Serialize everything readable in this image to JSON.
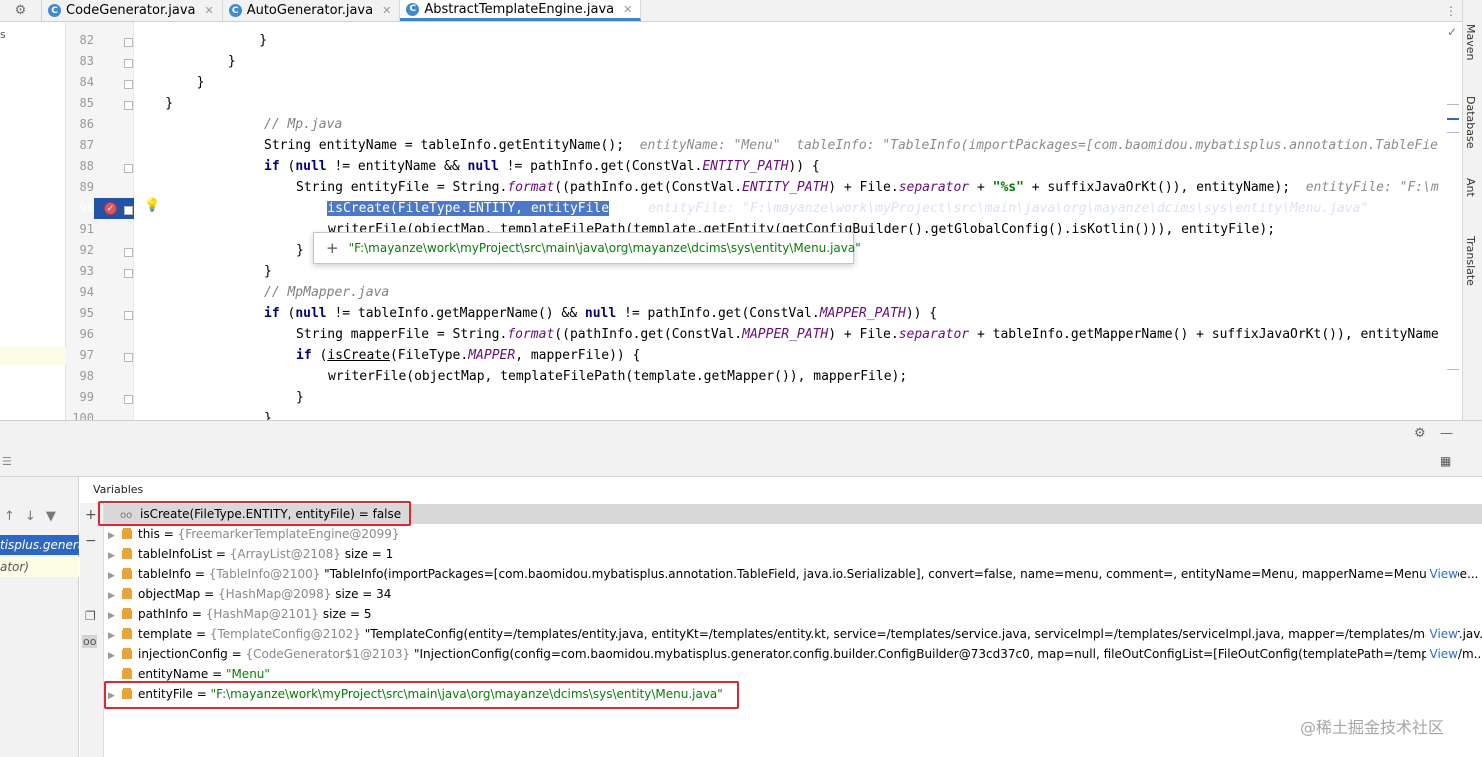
{
  "tabs": [
    {
      "label": "CodeGenerator.java",
      "icon": "C",
      "active": false
    },
    {
      "label": "AutoGenerator.java",
      "icon": "C",
      "active": false
    },
    {
      "label": "AbstractTemplateEngine.java",
      "icon": "C",
      "active": true
    }
  ],
  "left_labels": {
    "top": "s"
  },
  "line_numbers": [
    "82",
    "83",
    "84",
    "85",
    "86",
    "87",
    "88",
    "89",
    "90",
    "91",
    "92",
    "93",
    "94",
    "95",
    "96",
    "97",
    "98",
    "99",
    "100"
  ],
  "code": {
    "l82": "                }",
    "l83": "            }",
    "l84": "        }",
    "l85": "    }",
    "l86_comment": "// Mp.java",
    "l87_a": "String entityName = tableInfo.getEntityName();",
    "l87_hint": "entityName: \"Menu\"  tableInfo: \"TableInfo(importPackages=[com.baomidou.mybatisplus.annotation.TableFie",
    "l88_kw1": "if",
    "l88_a": " (",
    "l88_kw2": "null",
    "l88_b": " != entityName && ",
    "l88_kw3": "null",
    "l88_c": " != pathInfo.get(ConstVal.",
    "l88_it": "ENTITY_PATH",
    "l88_d": ")) {",
    "l89_a": "String entityFile = String.",
    "l89_it1": "format",
    "l89_b": "((pathInfo.get(ConstVal.",
    "l89_it2": "ENTITY_PATH",
    "l89_c": ") + File.",
    "l89_it3": "separator",
    "l89_d": " + ",
    "l89_str": "\"%s\"",
    "l89_e": " + suffixJavaOrKt()), entityName);",
    "l89_hint": "entityFile: \"F:\\m",
    "l90_a": "if (",
    "l90_sel1": "isCreate(FileType.ENTITY, ",
    "l90_sel2": "entityFile",
    "l90_b": ") {",
    "l90_hint": "entityFile: \"F:\\mayanze\\work\\myProject\\src\\main\\java\\org\\mayanze\\dcims\\sys\\entity\\Menu.java\"",
    "l91": "writerFile(objectMap, templateFilePath(template.getEntity(getConfigBuilder().getGlobalConfig().isKotlin())), entityFile);",
    "l92": "}",
    "l93": "}",
    "l94_comment": "// MpMapper.java",
    "l95_kw1": "if",
    "l95_a": " (",
    "l95_kw2": "null",
    "l95_b": " != tableInfo.getMapperName() && ",
    "l95_kw3": "null",
    "l95_c": " != pathInfo.get(ConstVal.",
    "l95_it": "MAPPER_PATH",
    "l95_d": ")) {",
    "l96_a": "String mapperFile = String.",
    "l96_it1": "format",
    "l96_b": "((pathInfo.get(ConstVal.",
    "l96_it2": "MAPPER_PATH",
    "l96_c": ") + File.",
    "l96_it3": "separator",
    "l96_d": " + tableInfo.getMapperName() + suffixJavaOrKt()), entityName",
    "l97_kw": "if",
    "l97_a": " (",
    "l97_u": "isCreate",
    "l97_b": "(FileType.",
    "l97_it": "MAPPER",
    "l97_c": ", mapperFile)) {",
    "l98": "writerFile(objectMap, templateFilePath(template.getMapper()), mapperFile);",
    "l99": "}",
    "l100": "}"
  },
  "tooltip": {
    "plus": "+",
    "value": "\"F:\\mayanze\\work\\myProject\\src\\main\\java\\org\\mayanze\\dcims\\sys\\entity\\Menu.java\""
  },
  "right_tools": [
    "Maven",
    "Database",
    "Ant",
    "Translate"
  ],
  "frames": {
    "selected": "tisplus.genera",
    "next": "ator)"
  },
  "variables": {
    "title": "Variables",
    "watch": {
      "expr": "isCreate(FileType.ENTITY, entityFile) = false"
    },
    "rows": [
      {
        "name": "this",
        "eq": " = ",
        "type": "{FreemarkerTemplateEngine@2099}",
        "value": "",
        "view": ""
      },
      {
        "name": "tableInfoList",
        "eq": " = ",
        "type": "{ArrayList@2108}",
        "value": "  size = 1",
        "view": ""
      },
      {
        "name": "tableInfo",
        "eq": " = ",
        "type": "{TableInfo@2100}",
        "value": " \"TableInfo(importPackages=[com.baomidou.mybatisplus.annotation.TableField, java.io.Serializable], convert=false, name=menu, comment=, entityName=Menu, mapperName=MenuMappe...",
        "view": "View"
      },
      {
        "name": "objectMap",
        "eq": " = ",
        "type": "{HashMap@2098}",
        "value": "  size = 34",
        "view": ""
      },
      {
        "name": "pathInfo",
        "eq": " = ",
        "type": "{HashMap@2101}",
        "value": "  size = 5",
        "view": ""
      },
      {
        "name": "template",
        "eq": " = ",
        "type": "{TemplateConfig@2102}",
        "value": " \"TemplateConfig(entity=/templates/entity.java, entityKt=/templates/entity.kt, service=/templates/service.java, serviceImpl=/templates/serviceImpl.java, mapper=/templates/mapper.jav...",
        "view": "View"
      },
      {
        "name": "injectionConfig",
        "eq": " = ",
        "type": "{CodeGenerator$1@2103}",
        "value": " \"InjectionConfig(config=com.baomidou.mybatisplus.generator.config.builder.ConfigBuilder@73cd37c0, map=null, fileOutConfigList=[FileOutConfig(templatePath=/templates/m...",
        "view": "View"
      },
      {
        "name": "entityName",
        "eq": " = ",
        "type": "",
        "value": "",
        "str": "\"Menu\"",
        "view": ""
      },
      {
        "name": "entityFile",
        "eq": " = ",
        "type": "",
        "value": "",
        "str": "\"F:\\mayanze\\work\\myProject\\src\\main\\java\\org\\mayanze\\dcims\\sys\\entity\\Menu.java\"",
        "view": ""
      }
    ]
  },
  "watermark": "@稀土掘金技术社区",
  "colors": {
    "exec_line": "#2154a8",
    "highlight_box": "#e3262b",
    "string": "#0a7d0a",
    "keyword": "#000080"
  }
}
